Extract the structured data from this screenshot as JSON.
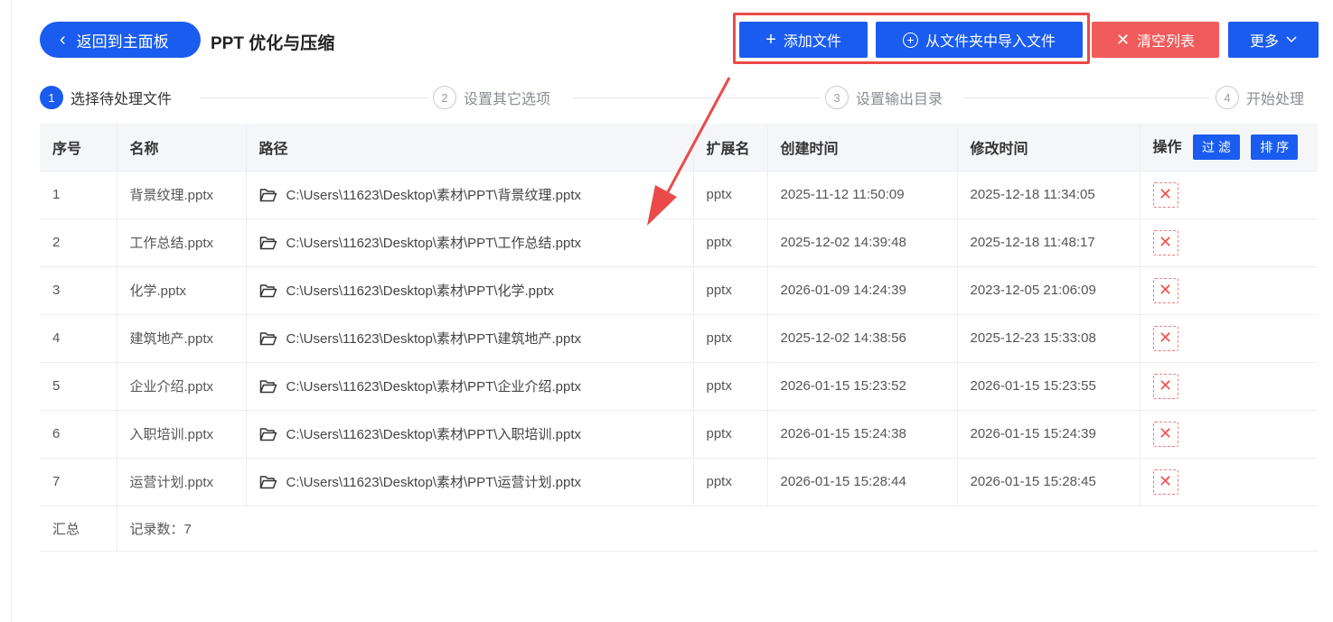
{
  "header": {
    "back_label": "返回到主面板",
    "back_icon": "chevron-left-icon",
    "title": "PPT 优化与压缩",
    "add_label": "添加文件",
    "import_label": "从文件夹中导入文件",
    "clear_label": "清空列表",
    "more_label": "更多"
  },
  "steps": [
    {
      "num": "1",
      "label": "选择待处理文件"
    },
    {
      "num": "2",
      "label": "设置其它选项"
    },
    {
      "num": "3",
      "label": "设置输出目录"
    },
    {
      "num": "4",
      "label": "开始处理"
    }
  ],
  "table": {
    "headers": {
      "index": "序号",
      "name": "名称",
      "path": "路径",
      "ext": "扩展名",
      "created": "创建时间",
      "modified": "修改时间",
      "actions": "操作",
      "filter": "过 滤",
      "sort": "排 序"
    },
    "rows": [
      {
        "index": "1",
        "name": "背景纹理.pptx",
        "path": "C:\\Users\\11623\\Desktop\\素材\\PPT\\背景纹理.pptx",
        "ext": "pptx",
        "created": "2025-11-12 11:50:09",
        "modified": "2025-12-18 11:34:05"
      },
      {
        "index": "2",
        "name": "工作总结.pptx",
        "path": "C:\\Users\\11623\\Desktop\\素材\\PPT\\工作总结.pptx",
        "ext": "pptx",
        "created": "2025-12-02 14:39:48",
        "modified": "2025-12-18 11:48:17"
      },
      {
        "index": "3",
        "name": "化学.pptx",
        "path": "C:\\Users\\11623\\Desktop\\素材\\PPT\\化学.pptx",
        "ext": "pptx",
        "created": "2026-01-09 14:24:39",
        "modified": "2023-12-05 21:06:09"
      },
      {
        "index": "4",
        "name": "建筑地产.pptx",
        "path": "C:\\Users\\11623\\Desktop\\素材\\PPT\\建筑地产.pptx",
        "ext": "pptx",
        "created": "2025-12-02 14:38:56",
        "modified": "2025-12-23 15:33:08"
      },
      {
        "index": "5",
        "name": "企业介绍.pptx",
        "path": "C:\\Users\\11623\\Desktop\\素材\\PPT\\企业介绍.pptx",
        "ext": "pptx",
        "created": "2026-01-15 15:23:52",
        "modified": "2026-01-15 15:23:55"
      },
      {
        "index": "6",
        "name": "入职培训.pptx",
        "path": "C:\\Users\\11623\\Desktop\\素材\\PPT\\入职培训.pptx",
        "ext": "pptx",
        "created": "2026-01-15 15:24:38",
        "modified": "2026-01-15 15:24:39"
      },
      {
        "index": "7",
        "name": "运营计划.pptx",
        "path": "C:\\Users\\11623\\Desktop\\素材\\PPT\\运营计划.pptx",
        "ext": "pptx",
        "created": "2026-01-15 15:28:44",
        "modified": "2026-01-15 15:28:45"
      }
    ],
    "summary": {
      "label": "汇总",
      "count_text": "记录数：7"
    }
  },
  "colors": {
    "primary": "#1a5cf0",
    "danger": "#f15b5b",
    "highlight": "#ea4a4a"
  }
}
